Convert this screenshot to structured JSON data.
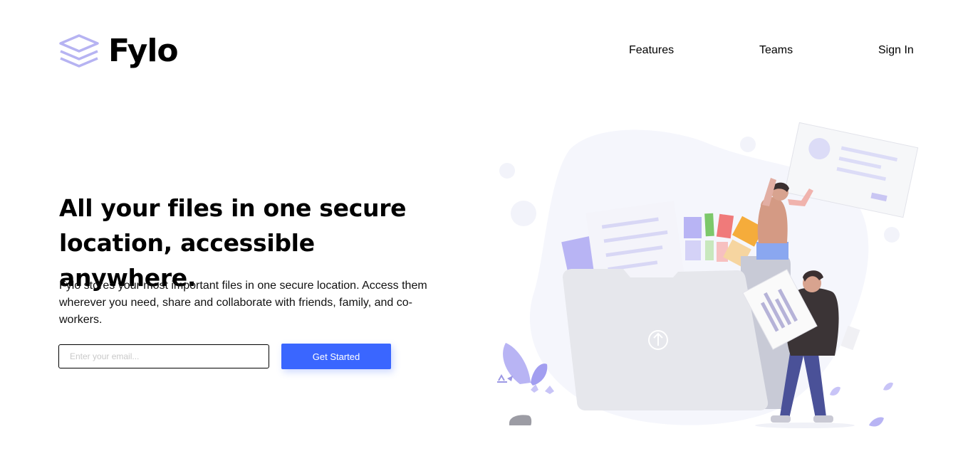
{
  "brand": {
    "name": "Fylo",
    "accent": "#3a66ff",
    "logo_color": "#b6b3f2"
  },
  "nav": {
    "items": [
      {
        "label": "Features"
      },
      {
        "label": "Teams"
      },
      {
        "label": "Sign In"
      }
    ]
  },
  "hero": {
    "title": "All your files in one secure location, accessible anywhere.",
    "description": "Fylo stores your most important files in one secure location. Access them wherever you need, share and collaborate with friends, family, and co-workers.",
    "email_placeholder": "Enter your email...",
    "email_value": "",
    "cta_label": "Get Started"
  },
  "illustration": {
    "icon": "upload-arrow-icon"
  }
}
